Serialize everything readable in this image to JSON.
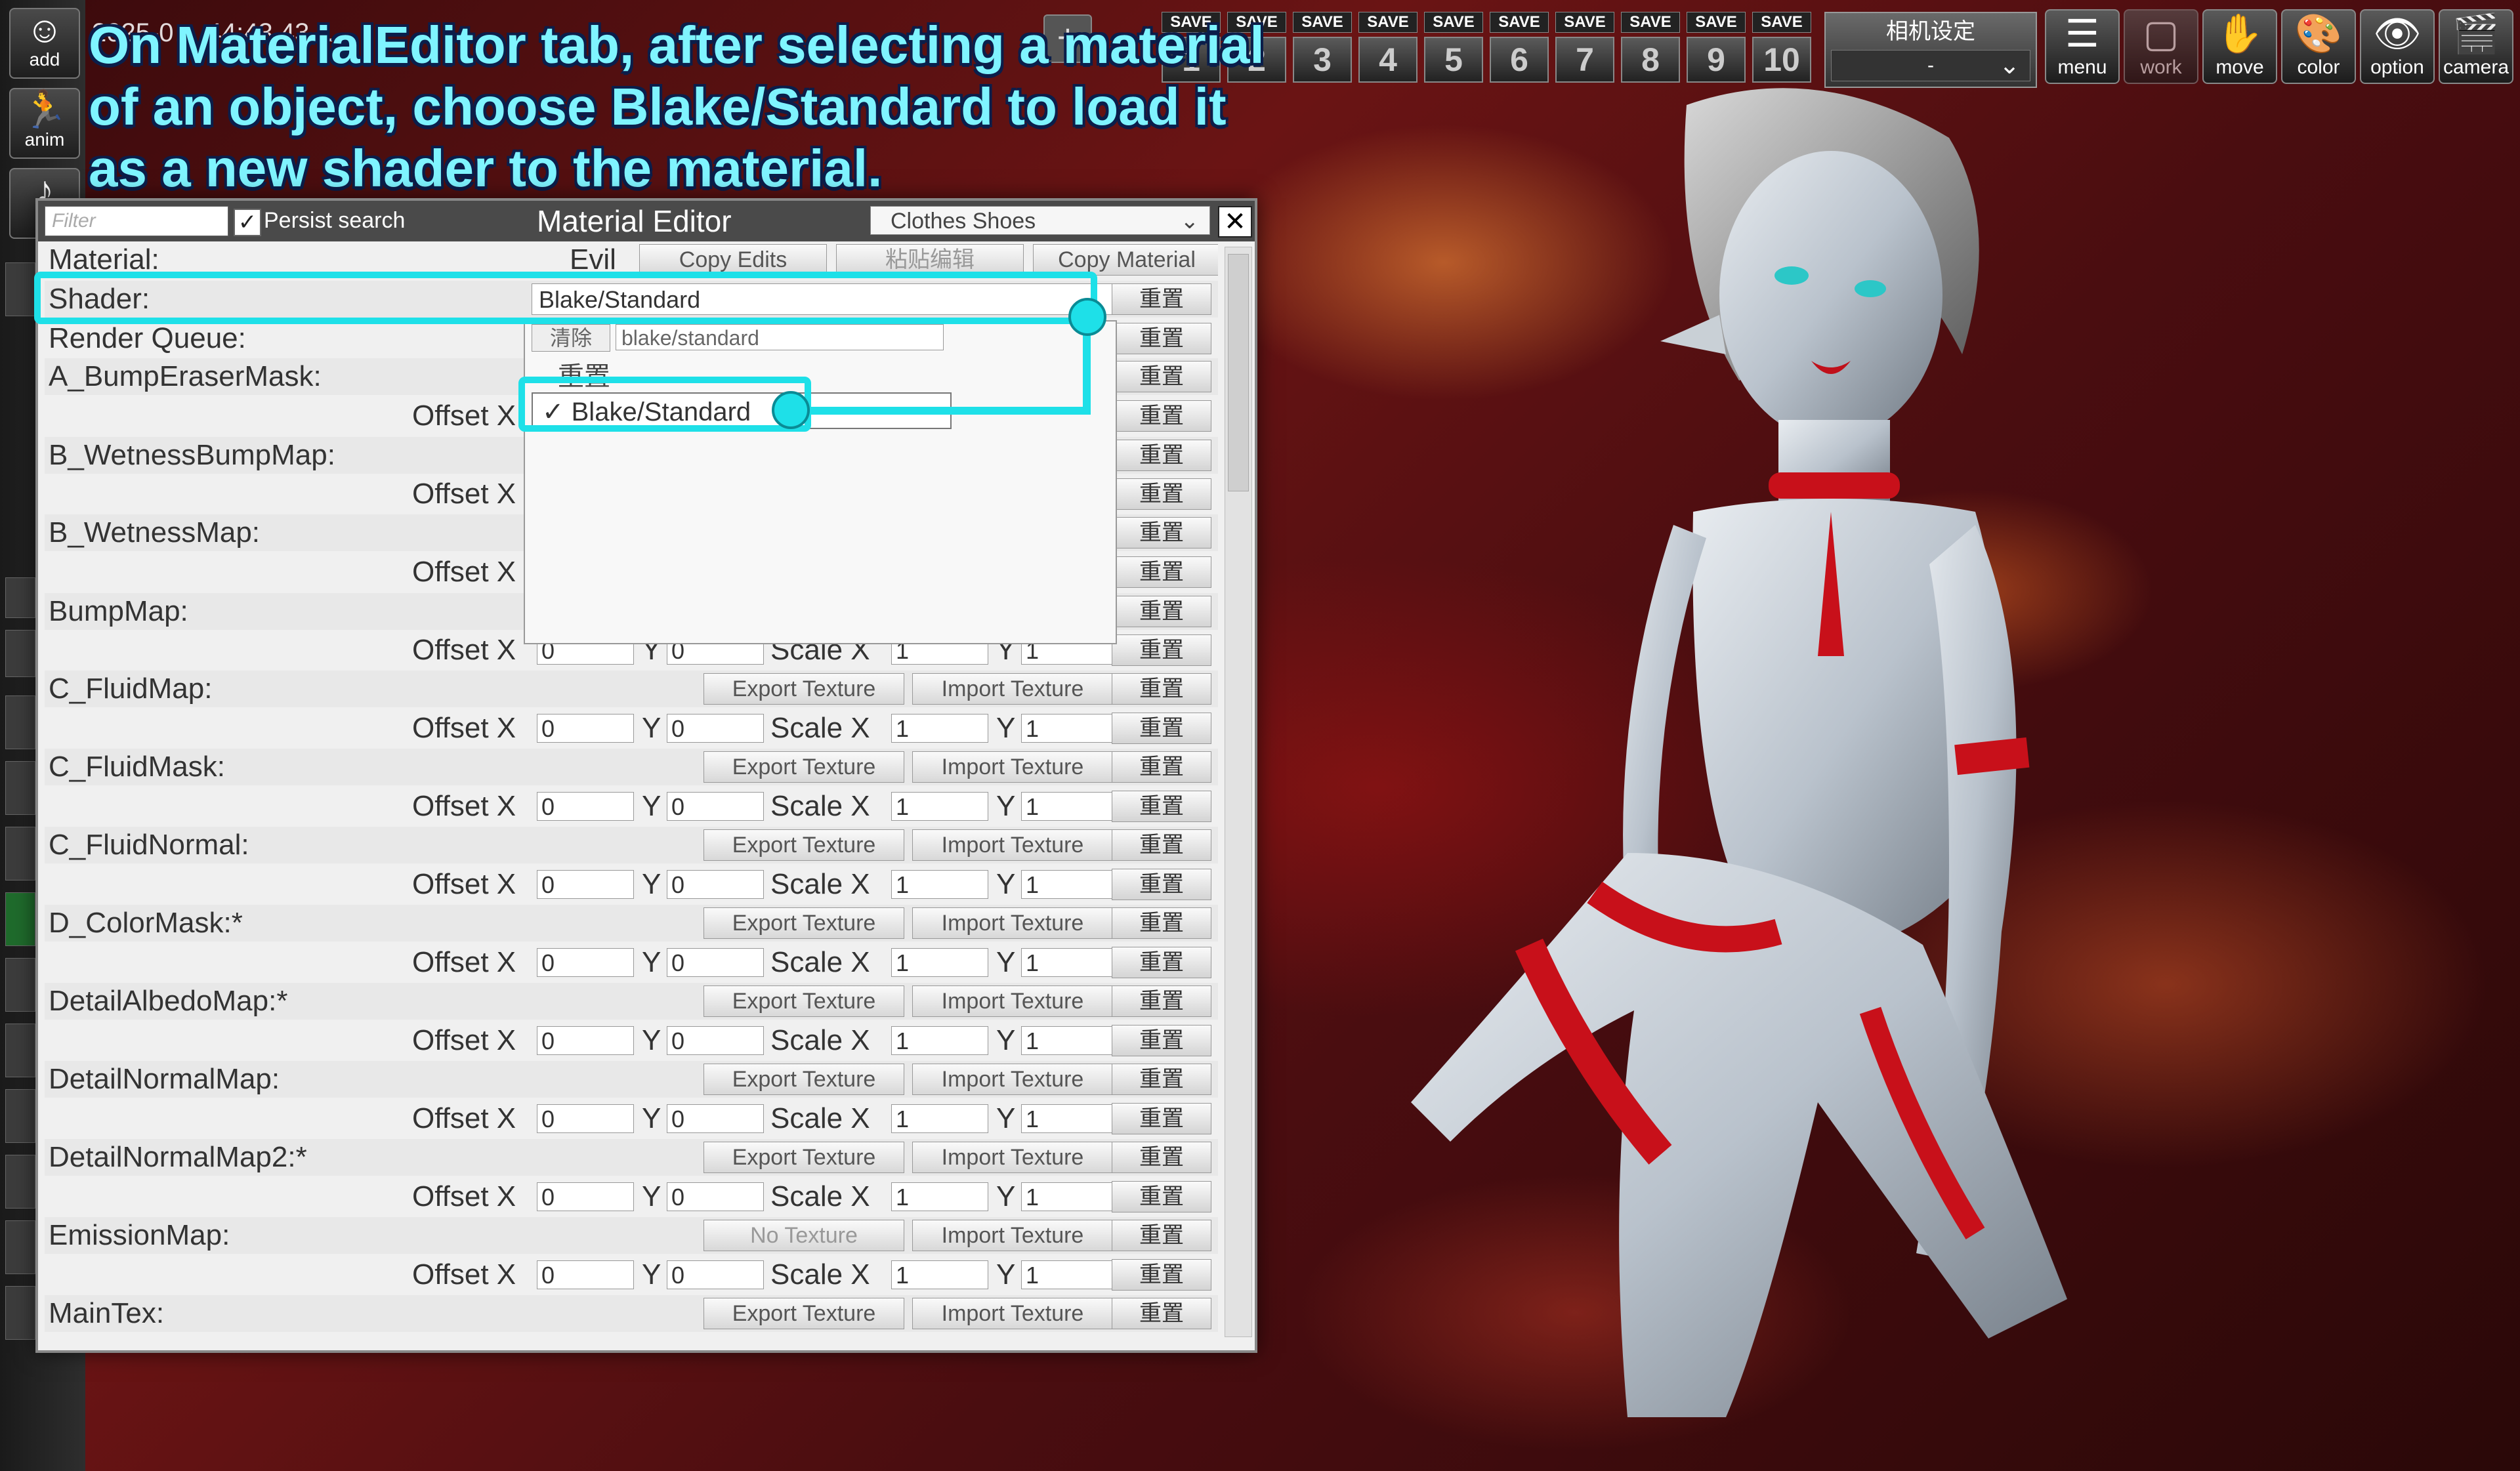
{
  "instruction": {
    "line1": "On MaterialEditor tab, after selecting a material",
    "line2": "of an object, choose Blake/Standard to load it",
    "line3": "as a new shader to the material."
  },
  "top_bar": {
    "title_fragment": "2025-0… 44:43  43…",
    "plus": "+",
    "save_label": "SAVE",
    "save_slots": [
      "1",
      "2",
      "3",
      "4",
      "5",
      "6",
      "7",
      "8",
      "9",
      "10"
    ],
    "camera_preset": {
      "title": "相机设定",
      "value": "-"
    },
    "tools": [
      {
        "label": "menu",
        "icon": "menu-icon"
      },
      {
        "label": "work",
        "icon": "work-icon"
      },
      {
        "label": "move",
        "icon": "hand-icon"
      },
      {
        "label": "color",
        "icon": "palette-icon"
      },
      {
        "label": "option",
        "icon": "eye-icon"
      },
      {
        "label": "camera",
        "icon": "clapper-icon"
      }
    ]
  },
  "left_toolbar": {
    "add": "add",
    "anim": "anim"
  },
  "editor": {
    "filter_placeholder": "Filter",
    "persist_search": "Persist search",
    "title": "Material Editor",
    "target": "Clothes Shoes",
    "close": "✕",
    "material_label": "Material:",
    "material_name": "Evil",
    "copy_edits": "Copy Edits",
    "paste_edits": "粘贴编辑",
    "copy_material": "Copy Material",
    "shader_label": "Shader:",
    "shader_value": "Blake/Standard",
    "render_queue": "Render Queue:",
    "reset": "重置",
    "offset_x": "Offset X",
    "y": "Y",
    "scale_x": "Scale X",
    "export_texture": "Export Texture",
    "import_texture": "Import Texture",
    "no_texture": "No Texture",
    "zero": "0",
    "one": "1",
    "dropdown": {
      "clear": "清除",
      "search": "blake/standard",
      "reset": "重置",
      "option": "✓ Blake/Standard"
    },
    "textures": [
      "A_BumpEraserMask:",
      "B_WetnessBumpMap:",
      "B_WetnessMap:",
      "BumpMap:",
      "C_FluidMap:",
      "C_FluidMask:",
      "C_FluidNormal:",
      "D_ColorMask:*",
      "DetailAlbedoMap:*",
      "DetailNormalMap:",
      "DetailNormalMap2:*",
      "EmissionMap:",
      "MainTex:"
    ]
  },
  "colors": {
    "highlight": "#1ee0e8",
    "instruction_text": "#7ff4ff"
  }
}
